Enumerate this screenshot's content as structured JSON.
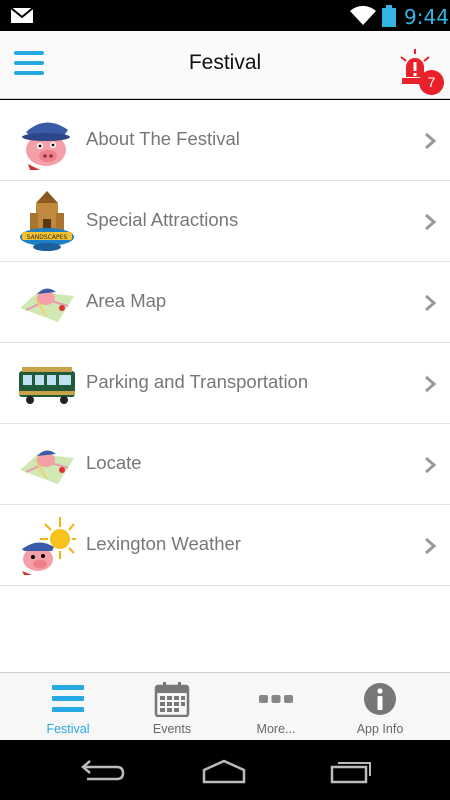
{
  "status_bar": {
    "time": "9:44",
    "icons": [
      "mail-icon",
      "wifi-icon",
      "battery-icon"
    ]
  },
  "header": {
    "title": "Festival",
    "menu_icon": "hamburger-menu-icon",
    "alert_icon": "siren-alert-icon",
    "alert_count": "7"
  },
  "list": {
    "items": [
      {
        "label": "About The Festival",
        "icon": "pig-mascot-icon"
      },
      {
        "label": "Special Attractions",
        "icon": "sandscapes-castle-icon"
      },
      {
        "label": "Area Map",
        "icon": "pig-map-icon"
      },
      {
        "label": "Parking and Transportation",
        "icon": "trolley-icon"
      },
      {
        "label": "Locate",
        "icon": "pig-map-icon"
      },
      {
        "label": "Lexington Weather",
        "icon": "pig-sun-icon"
      }
    ]
  },
  "tabbar": {
    "tabs": [
      {
        "label": "Festival",
        "icon": "list-icon",
        "active": true
      },
      {
        "label": "Events",
        "icon": "calendar-icon"
      },
      {
        "label": "More...",
        "icon": "more-dots-icon"
      },
      {
        "label": "App Info",
        "icon": "info-icon"
      }
    ]
  },
  "colors": {
    "accent": "#25a9e0",
    "badge": "#e8212b",
    "status_time": "#33b5e5"
  }
}
